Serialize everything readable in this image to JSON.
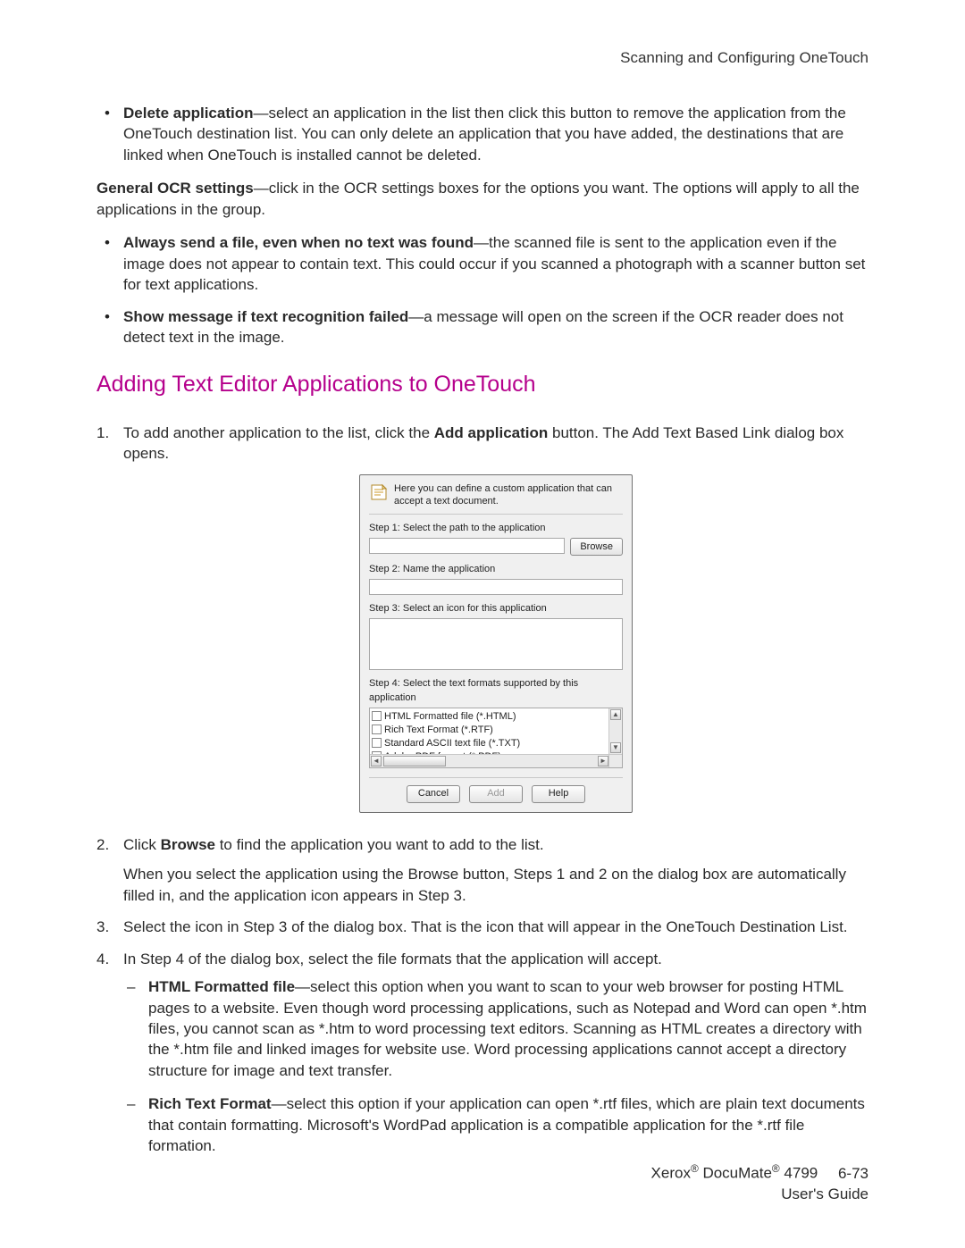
{
  "header": {
    "title": "Scanning and Configuring OneTouch"
  },
  "bullets_top": [
    {
      "term": "Delete application",
      "text": "—select an application in the list then click this button to remove the application from the OneTouch destination list. You can only delete an application that you have added, the destinations that are linked when OneTouch is installed cannot be deleted."
    }
  ],
  "general_ocr": {
    "term": "General OCR settings",
    "text": "—click in the OCR settings boxes for the options you want. The options will apply to all the applications in the group."
  },
  "bullets_ocr": [
    {
      "term": "Always send a file, even when no text was found",
      "text": "—the scanned file is sent to the application even if the image does not appear to contain text. This could occur if you scanned a photograph with a scanner button set for text applications."
    },
    {
      "term": "Show message if text recognition failed",
      "text": "—a message will open on the screen if the OCR reader does not detect text in the image."
    }
  ],
  "section_heading": "Adding Text Editor Applications to OneTouch",
  "step1": {
    "pre": "To add another application to the list, click the ",
    "bold": "Add application",
    "post": " button. The Add Text Based Link dialog box opens."
  },
  "dialog": {
    "head": "Here you can define a custom application that can accept a text document.",
    "step1": "Step 1: Select the path to the application",
    "browse": "Browse",
    "step2": "Step 2: Name the application",
    "step3": "Step 3: Select an icon for this application",
    "step4": "Step 4: Select the text formats supported by this application",
    "formats": [
      "HTML Formatted file (*.HTML)",
      "Rich Text Format (*.RTF)",
      "Standard ASCII text file (*.TXT)",
      "Adobe PDF format (*.PDF)"
    ],
    "cancel": "Cancel",
    "add": "Add",
    "help": "Help"
  },
  "step2": {
    "pre": "Click ",
    "bold": "Browse",
    "post": " to find the application you want to add to the list."
  },
  "step2_cont": "When you select the application using the Browse button, Steps 1 and 2 on the dialog box are automatically filled in, and the application icon appears in Step 3.",
  "step3": "Select the icon in Step 3 of the dialog box. That is the icon that will appear in the OneTouch Destination List.",
  "step4": "In Step 4 of the dialog box, select the file formats that the application will accept.",
  "step4_dashes": [
    {
      "term": "HTML Formatted file",
      "text": "—select this option when you want to scan to your web browser for posting HTML pages to a website. Even though word processing applications, such as Notepad and Word can open *.htm files, you cannot scan as *.htm to word processing text editors. Scanning as HTML creates a directory with the *.htm file and linked images for website use. Word processing applications cannot accept a directory structure for image and text transfer."
    },
    {
      "term": "Rich Text Format",
      "text": "—select this option if your application can open *.rtf files, which are plain text documents that contain formatting. Microsoft's WordPad application is a compatible application for the *.rtf file formation."
    }
  ],
  "footer": {
    "product_a": "Xerox",
    "product_b": " DocuMate",
    "product_c": " 4799",
    "page": "6-73",
    "guide": "User's Guide"
  }
}
